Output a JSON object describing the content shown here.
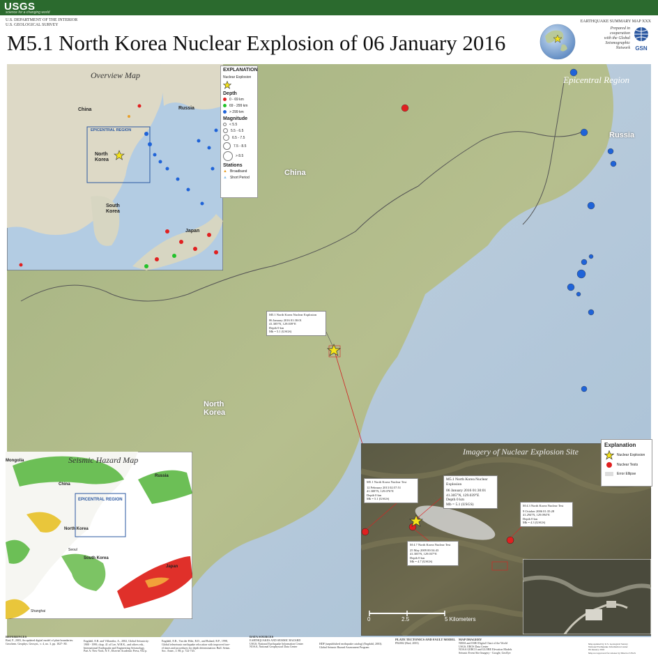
{
  "header": {
    "logo": "USGS",
    "tagline": "science for a changing world",
    "dept_line1": "U.S. DEPARTMENT OF THE INTERIOR",
    "dept_line2": "U.S. GEOLOGICAL SURVEY",
    "map_number": "EARTHQUAKE SUMMARY MAP XXX",
    "title": "M5.1 North Korea Nuclear Explosion of 06 January 2016",
    "cooperation": [
      "Prepared in",
      "cooperation",
      "with the Global",
      "Seismographic",
      "Network"
    ],
    "gsn": "GSN"
  },
  "main_map": {
    "title": "Epicentral Region",
    "labels": {
      "china": "China",
      "russia": "Russia",
      "north_korea_1": "North",
      "north_korea_2": "Korea"
    },
    "event_callout": [
      "M5.1 North Korea Nuclear Explosion",
      "06 January 2016 01:30:01",
      "41.305°N, 129.039°E",
      "Depth 0 km",
      "Mb = 5.1 (USGS)"
    ]
  },
  "overview": {
    "title": "Overview Map",
    "labels": {
      "china": "China",
      "russia": "Russia",
      "north_korea_1": "North",
      "north_korea_2": "Korea",
      "south_korea_1": "South",
      "south_korea_2": "Korea",
      "japan": "Japan",
      "epicentral": "EPICENTRAL REGION"
    },
    "legend": {
      "title": "EXPLANATION",
      "nuclear": "Nuclear Explosion",
      "depth_h": "Depth",
      "depth": [
        "0 - 69 km",
        "69 - 299 km",
        "> 299 km"
      ],
      "mag_h": "Magnitude",
      "mag": [
        "< 5.5",
        "5.5 - 6.5",
        "6.5 - 7.5",
        "7.5 - 8.5",
        "> 8.5"
      ],
      "stations_h": "Stations",
      "stations": [
        "Broadband",
        "Short Period"
      ]
    }
  },
  "hazard": {
    "title": "Seismic Hazard Map",
    "labels": {
      "mongolia": "Mongolia",
      "russia": "Russia",
      "china": "China",
      "north_korea": "North Korea",
      "south_korea": "South Korea",
      "japan": "Japan",
      "epicentral": "EPICENTRAL REGION",
      "seoul": "Seoul",
      "shanghai": "Shanghai"
    }
  },
  "imagery": {
    "title": "Imagery of Nuclear Explosion Site",
    "legend": {
      "title": "Explanation",
      "items": [
        "Nuclear Explosion",
        "Nuclear Tests",
        "Error Ellipse"
      ]
    },
    "callout_2016": [
      "M5.1 North Korea Nuclear Explosion",
      "06 January 2016 01:30:01",
      "41.305°N, 129.039°E",
      "Depth 0 km",
      "Mb = 5.1 (USGS)"
    ],
    "callout_2013": [
      "M5.1 North Korea Nuclear Test",
      "12 February 2013 02:57:51",
      "41.308°N, 129.076°E",
      "Depth 0 km",
      "Mb = 5.1 (USGS)"
    ],
    "callout_2009": [
      "M 4.7 North Korea Nuclear Test",
      "25 May 2009 00:54:43",
      "41.303°N, 129.037°E",
      "Depth 0 km",
      "Mb = 4.7 (USGS)"
    ],
    "callout_2006": [
      "M 4.3 North Korea Nuclear Test",
      "9 October 2006 01:35:28",
      "41.294°N, 129.094°E",
      "Depth 0 km",
      "Mb = 4.3 (USGS)"
    ],
    "scale": {
      "t0": "0",
      "t1": "2.5",
      "t2": "5 Kilometers"
    }
  },
  "footer": {
    "refs_h": "REFERENCES",
    "ref1": [
      "Bird, P., 2003, An updated digital model of plate boundaries:",
      "Geochem. Geophys. Geosyst., v. 4, no. 3, pp. 1027- 80."
    ],
    "ref2": [
      "Engdahl, E.R. and Villaseñor, A., 2002, Global Seismicity:",
      "1900 - 1999, chap. 41 of Lee, W.H.K., and others eds.,",
      "International Earthquake and Engineering Seismology,",
      "Part A: New York, N.Y., Elsevier Academic Press, 932 p."
    ],
    "ref3": [
      "Engdahl, E.R., Van der Hilst, R.D., and Buland, R.P., 1998,",
      "Global teleseismic earthquake relocation with improved trav-",
      "el times and procedures for depth determination: Bull. Seism.",
      "Soc. Amer., v. 88, p. 722-743."
    ],
    "data_h": "DATA SOURCES",
    "data": [
      "EARTHQUAKES AND SEISMIC HAZARD",
      "USGS, National Earthquake Information Center",
      "NOAA, National Geophysical Data Center"
    ],
    "hdf": [
      "HDF (unpublished earthquake catalog) (Engdahl, 2003).",
      "Global Seismic Hazard Assessment Program"
    ],
    "plate_h": "PLATE TECTONICS AND FAULT MODEL",
    "plate": [
      "PB2002 (Bird, 2003)"
    ],
    "imagery_h": "MAP IMAGERY",
    "imagery": [
      "NIMA and ESRI Digital Chart of the World",
      "USGS, EROS Data Center",
      "NOAA GEBCO and GLOBE Elevation Models",
      "Seismic Event Site Imagery - Google, GeoEye"
    ],
    "updated": [
      "Map updated by U.S. Geological Survey",
      "National Earthquake Information Center",
      "06 January 2016",
      "Map not approved for release by Director USGS"
    ]
  },
  "colors": {
    "usgs_green": "#2b6a2e",
    "shallow": "#e02020",
    "intermediate": "#22c22a",
    "deep": "#1f63d8",
    "star": "#f5e31a"
  }
}
